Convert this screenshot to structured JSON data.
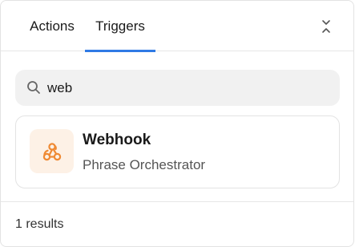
{
  "tabs": [
    {
      "label": "Actions",
      "active": false
    },
    {
      "label": "Triggers",
      "active": true
    }
  ],
  "collapse_icon": "chevrons-collapse-icon",
  "search": {
    "value": "web",
    "icon": "search-icon"
  },
  "results": [
    {
      "title": "Webhook",
      "subtitle": "Phrase Orchestrator",
      "icon": "webhook-icon",
      "icon_color": "#ef8a34",
      "icon_bg": "#fdf1e6"
    }
  ],
  "footer": {
    "count_label": "1 results"
  },
  "colors": {
    "accent": "#2f7ae5"
  }
}
